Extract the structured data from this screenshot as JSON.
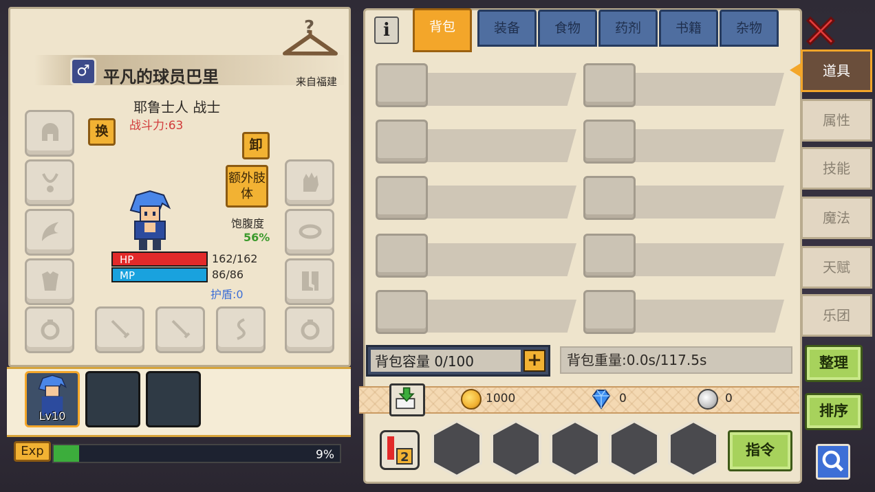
{
  "character": {
    "name": "平凡的球员巴里",
    "origin": "来自福建",
    "race_class": "耶鲁士人 战士",
    "combat_power": "战斗力:63",
    "gender_symbol": "♂",
    "hunger_label": "饱腹度",
    "hunger_value": "56%",
    "hp_label": "HP",
    "hp_value": "162/162",
    "mp_label": "MP",
    "mp_value": "86/86",
    "shield": "护盾:0",
    "swap_btn": "换",
    "unequip_btn": "卸",
    "extra_limb_btn": "额外肢体",
    "icons": [
      "helmet-icon",
      "necklace-icon",
      "wing-icon",
      "armor-icon",
      "ring-icon",
      "sword-icon",
      "sword-icon",
      "whip-icon",
      "gloves-icon",
      "bracelet-icon",
      "boots-icon",
      "ring-icon",
      "hanger-icon"
    ]
  },
  "party": {
    "level_label": "Lv10"
  },
  "exp": {
    "tag": "Exp",
    "percent_label": "9%",
    "fraction": 0.09
  },
  "inventory": {
    "tabs": [
      "背包",
      "装备",
      "食物",
      "药剂",
      "书籍",
      "杂物"
    ],
    "active_tab": "背包",
    "info_label": "i",
    "capacity": "背包容量 0/100",
    "capacity_plus": "+",
    "weight": "背包重量:0.0s/117.5s",
    "gold": "1000",
    "gems": "0",
    "silver": "0",
    "command_btn": "指令"
  },
  "side_tabs": {
    "items": [
      "道具",
      "属性",
      "技能",
      "魔法",
      "天赋",
      "乐团"
    ],
    "active": "道具",
    "sort_btn": "整理",
    "order_btn": "排序"
  },
  "colors": {
    "accent": "#f3a62a",
    "hp": "#e22a2a",
    "mp": "#19a2de",
    "power": "#d23b3b",
    "shield": "#3d6fd6",
    "hunger": "#3c9a2c"
  }
}
